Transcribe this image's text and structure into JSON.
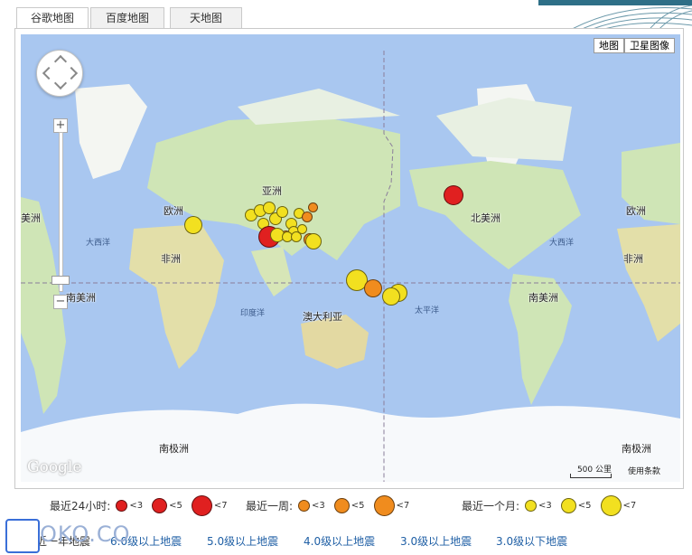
{
  "tabs": [
    {
      "label": "谷歌地图",
      "active": true
    },
    {
      "label": "百度地图",
      "active": false
    },
    {
      "label": "天地图",
      "active": false
    }
  ],
  "map": {
    "type_buttons": [
      "地图",
      "卫星图像"
    ],
    "continents": [
      "亚洲",
      "欧洲",
      "非洲",
      "北美洲",
      "南美洲",
      "澳大利亚",
      "南极洲"
    ],
    "labels": {
      "asia": "亚洲",
      "europe_left": "欧洲",
      "europe_right": "欧洲",
      "africa_left": "非洲",
      "africa_right": "非洲",
      "north_america": "北美洲",
      "south_america_left": "南美洲",
      "south_america_right": "南美洲",
      "america_edge": "美洲",
      "australia": "澳大利亚",
      "antarctica_left": "南极洲",
      "antarctica_right": "南极洲",
      "atlantic_left": "大西洋",
      "atlantic_right": "大西洋",
      "indian_ocean": "印度洋",
      "pacific": "太平洋"
    },
    "attribution": "Google",
    "scale": "500 公里",
    "terms": "使用条款"
  },
  "colors": {
    "red": "#e02020",
    "orange": "#f08c1e",
    "yellow": "#f2e020",
    "water": "#a9c7f0",
    "land": "#cfe5b6",
    "ice": "#ffffff"
  },
  "legend": [
    {
      "title": "最近24小时:",
      "color": "red",
      "items": [
        "<3",
        "<5",
        "<7"
      ]
    },
    {
      "title": "最近一周:",
      "color": "orange",
      "items": [
        "<3",
        "<5",
        "<7"
      ]
    },
    {
      "title": "最近一个月:",
      "color": "yellow",
      "items": [
        "<3",
        "<5",
        "<7"
      ]
    }
  ],
  "links": [
    "最近一年地震",
    "6.0级以上地震",
    "5.0级以上地震",
    "4.0级以上地震",
    "3.0级以上地震",
    "3.0级以下地震"
  ],
  "logo": "OKO.CO"
}
